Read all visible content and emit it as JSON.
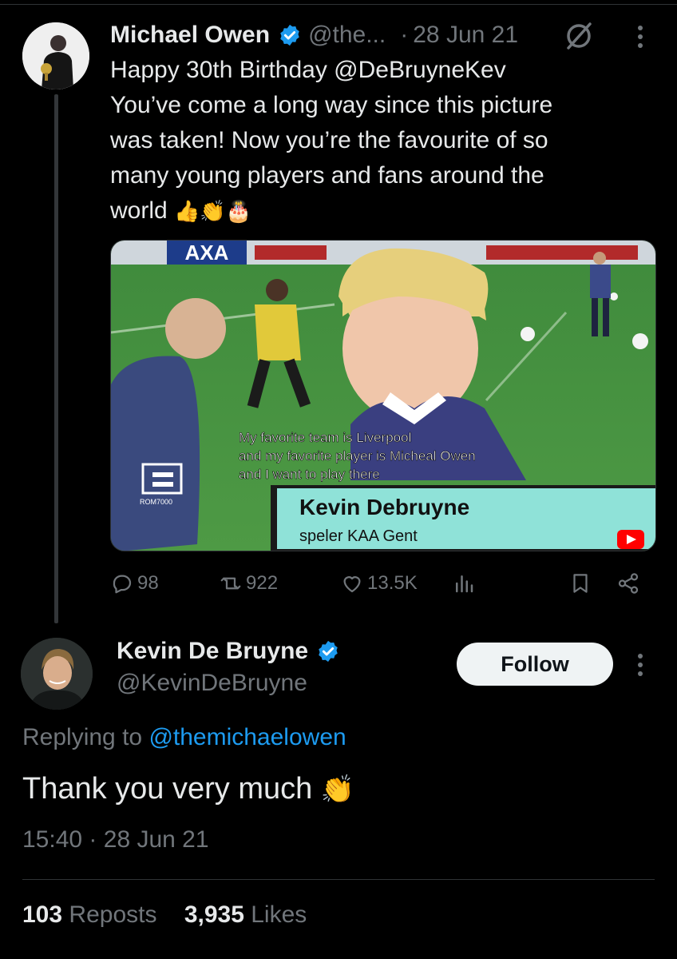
{
  "parent_tweet": {
    "name": "Michael Owen",
    "handle": "@the...",
    "separator": "·",
    "date": "28 Jun 21",
    "text_lines": [
      "Happy 30th Birthday @DeBruyneKev",
      "You’ve come a long way since this picture",
      "was taken! Now you’re the favourite of so",
      "many young players and fans around the",
      "world"
    ],
    "emojis": "👍👏🎂",
    "media": {
      "banner_text": "AXA",
      "subtitle_lines": [
        "My favorite team is Liverpool",
        "and my favorite player is Micheal Owen",
        "and I want to play there"
      ],
      "lower_third_name": "Kevin Debruyne",
      "lower_third_caption": "speler KAA Gent",
      "channel_logo_text": "ROM7000"
    },
    "actions": {
      "replies": "98",
      "reposts": "922",
      "likes": "13.5K"
    }
  },
  "reply_tweet": {
    "name": "Kevin De Bruyne",
    "handle": "@KevinDeBruyne",
    "follow_label": "Follow",
    "replying_prefix": "Replying to",
    "replying_to": "@themichaelowen",
    "text": "Thank you very much",
    "emoji": "👏",
    "time": "15:40",
    "separator": "·",
    "date": "28 Jun 21",
    "reposts_count": "103",
    "reposts_label": "Reposts",
    "likes_count": "3,935",
    "likes_label": "Likes"
  },
  "colors": {
    "background": "#000000",
    "text": "#e7e9ea",
    "muted": "#71767b",
    "link": "#1d9bf0",
    "verified": "#1d9bf0",
    "divider": "#2f3336"
  },
  "icons": [
    "verified-badge-icon",
    "grok-icon",
    "more-icon",
    "reply-icon",
    "repost-icon",
    "like-icon",
    "views-icon",
    "bookmark-icon",
    "share-icon",
    "youtube-icon"
  ]
}
